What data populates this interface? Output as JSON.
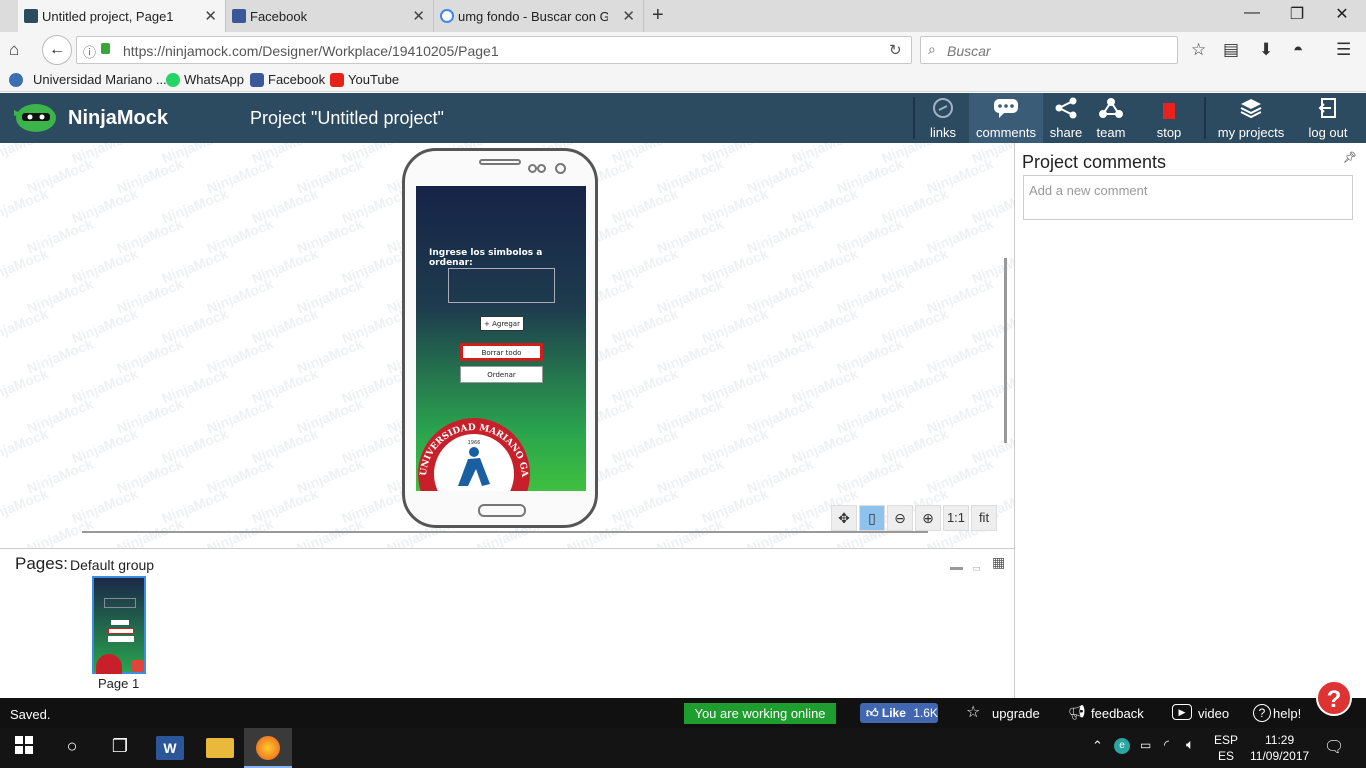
{
  "browser": {
    "tabs": [
      {
        "title": "Untitled project, Page1",
        "active": true
      },
      {
        "title": "Facebook",
        "active": false
      },
      {
        "title": "umg fondo - Buscar con Go",
        "active": false
      }
    ],
    "new_tab": "+",
    "url": "https://ninjamock.com/Designer/Workplace/19410205/Page1",
    "search_placeholder": "Buscar",
    "bookmarks": [
      {
        "label": "Universidad Mariano ...",
        "color": "#3c6fb2"
      },
      {
        "label": "WhatsApp",
        "color": "#25d366"
      },
      {
        "label": "Facebook",
        "color": "#3b5998"
      },
      {
        "label": "YouTube",
        "color": "#e62117"
      }
    ]
  },
  "app": {
    "brand": "NinjaMock",
    "project_title": "Project \"Untitled project\"",
    "toolbar": [
      {
        "label": "links",
        "icon": "link-icon"
      },
      {
        "label": "comments",
        "icon": "comment-icon"
      },
      {
        "label": "share",
        "icon": "share-icon"
      },
      {
        "label": "team",
        "icon": "team-icon"
      },
      {
        "label": "stop",
        "icon": "stop-icon"
      },
      {
        "label": "my projects",
        "icon": "layers-icon"
      },
      {
        "label": "log out",
        "icon": "logout-icon"
      }
    ],
    "watermark": "NinjaMock"
  },
  "mockup": {
    "prompt": "Ingrese los simbolos a ordenar:",
    "add_button": "+ Agregar",
    "clear_button": "Borrar todo",
    "sort_button": "Ordenar",
    "seal_text": "UNIVERSIDAD MARIANO GALVEZ",
    "seal_year": "1966"
  },
  "zoom": {
    "one_to_one": "1:1",
    "fit": "fit"
  },
  "comments": {
    "title": "Project comments",
    "placeholder": "Add a new comment"
  },
  "pages": {
    "label": "Pages:",
    "group": "Default group",
    "items": [
      {
        "name": "Page 1"
      }
    ]
  },
  "status": {
    "saved": "Saved.",
    "online": "You are working online",
    "like": "Like",
    "like_count": "1.6K",
    "upgrade": "upgrade",
    "feedback": "feedback",
    "video": "video",
    "help": "help!"
  },
  "taskbar": {
    "lang_top": "ESP",
    "lang_bottom": "ES",
    "time": "11:29",
    "date": "11/09/2017"
  }
}
